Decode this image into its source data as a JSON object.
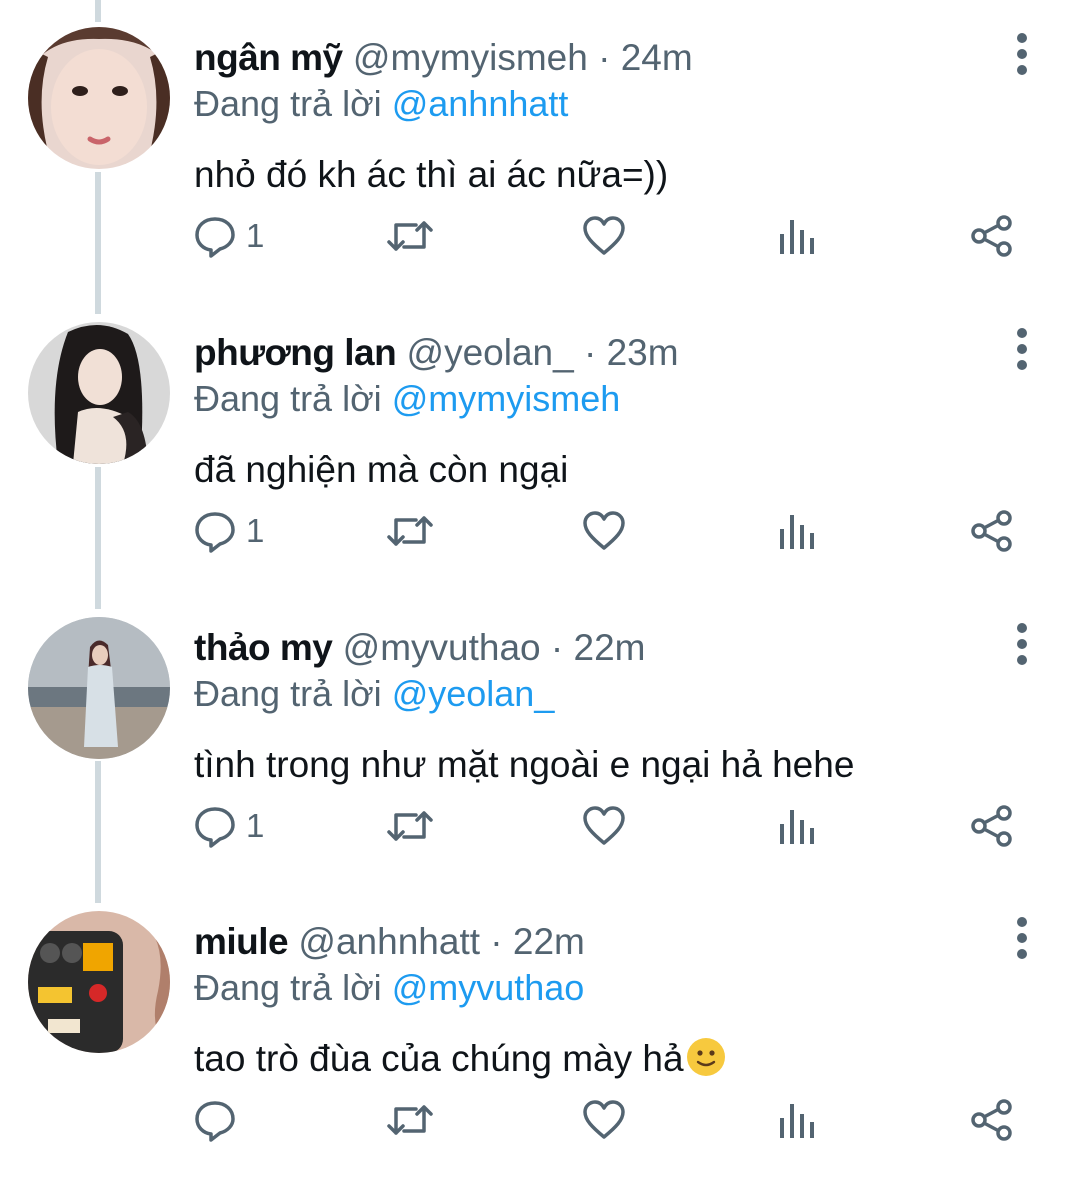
{
  "reply_prefix": "Đang trả lời",
  "tweets": [
    {
      "name": "ngân mỹ",
      "handle": "@mymyismeh",
      "sep": "·",
      "time": "24m",
      "reply_to": "@anhnhatt",
      "text": "nhỏ đó kh ác thì ai ác nữa=))",
      "reply_count": "1"
    },
    {
      "name": "phương lan",
      "handle": "@yeolan_",
      "sep": "·",
      "time": "23m",
      "reply_to": "@mymyismeh",
      "text": "đã nghiện mà còn ngại",
      "reply_count": "1"
    },
    {
      "name": "thảo my",
      "handle": "@myvuthao",
      "sep": "·",
      "time": "22m",
      "reply_to": "@yeolan_",
      "text": "tình trong như mặt ngoài e ngại hả hehe",
      "reply_count": "1"
    },
    {
      "name": "miule",
      "handle": "@anhnhatt",
      "sep": "·",
      "time": "22m",
      "reply_to": "@myvuthao",
      "text": "tao trò đùa của chúng mày hả",
      "text_emoji": "slightly-smiling-face-emoji",
      "reply_count": ""
    }
  ],
  "icons": {
    "reply": "reply-icon",
    "retweet": "retweet-icon",
    "like": "heart-icon",
    "views": "views-icon",
    "share": "share-icon",
    "more": "more-vertical-icon"
  },
  "colors": {
    "text_primary": "#0f1419",
    "text_secondary": "#536471",
    "mention": "#1d9bf0",
    "thread_line": "#cfd9de",
    "emoji": "#f7c93e"
  }
}
